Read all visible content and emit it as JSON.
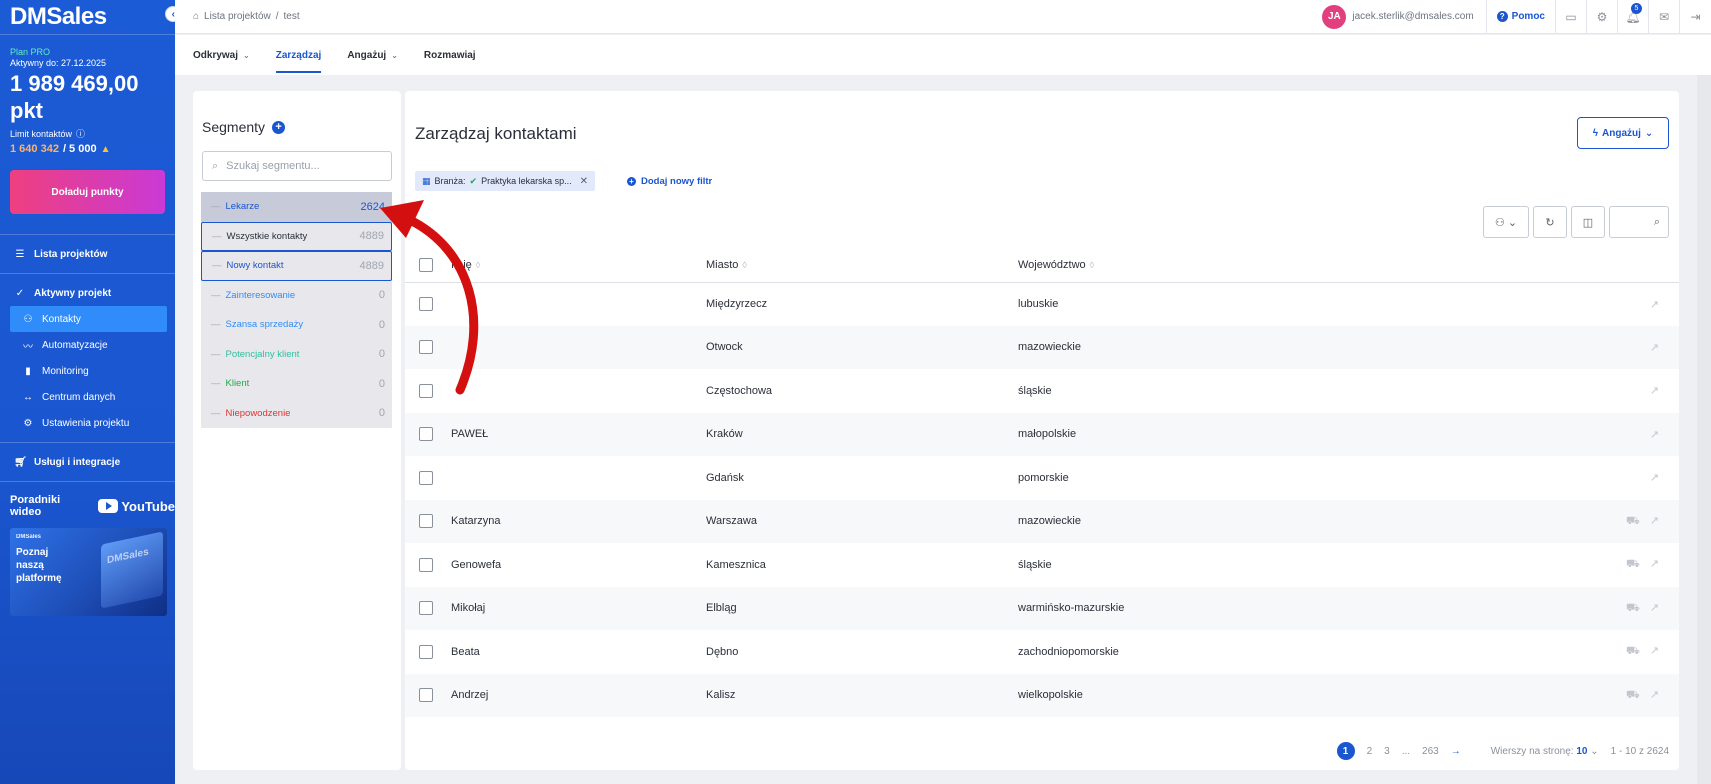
{
  "brand": {
    "logo": "DMSales"
  },
  "plan": {
    "name": "Plan PRO",
    "active_until": "Aktywny do: 27.12.2025",
    "points": "1 989 469,00",
    "points_unit": "pkt",
    "limit_label": "Limit kontaktów",
    "limit_used": "1 640 342",
    "limit_total": "/ 5 000",
    "topup_label": "Doładuj punkty"
  },
  "sidebar": {
    "items": [
      {
        "label": "Lista projektów",
        "icon": "list-icon"
      },
      {
        "label": "Aktywny projekt",
        "icon": "check-icon"
      },
      {
        "label": "Kontakty",
        "icon": "contacts-icon"
      },
      {
        "label": "Automatyzacje",
        "icon": "chart-line-icon"
      },
      {
        "label": "Monitoring",
        "icon": "bar-chart-icon"
      },
      {
        "label": "Centrum danych",
        "icon": "code-icon"
      },
      {
        "label": "Ustawienia projektu",
        "icon": "gear-icon"
      },
      {
        "label": "Usługi i integracje",
        "icon": "cart-icon"
      }
    ],
    "video_guides": "Poradniki wideo",
    "youtube": "YouTube",
    "promo_brand": "DMSales",
    "promo_text": "Poznaj naszą platformę"
  },
  "topbar": {
    "breadcrumb_root": "Lista projektów",
    "breadcrumb_sep": "/",
    "breadcrumb_current": "test",
    "avatar_initials": "JA",
    "user_email": "jacek.sterlik@dmsales.com",
    "help_label": "Pomoc",
    "notifications_count": "5"
  },
  "menu": {
    "items": [
      {
        "label": "Odkrywaj"
      },
      {
        "label": "Zarządzaj"
      },
      {
        "label": "Angażuj"
      },
      {
        "label": "Rozmawiaj"
      }
    ]
  },
  "segments": {
    "title": "Segmenty",
    "search_placeholder": "Szukaj segmentu...",
    "items": [
      {
        "name": "Lekarze",
        "count": "2624",
        "color": "#1a56cf"
      },
      {
        "name": "Wszystkie kontakty",
        "count": "4889",
        "color": "#2b2f3a"
      },
      {
        "name": "Nowy kontakt",
        "count": "4889",
        "color": "#1a56cf"
      },
      {
        "name": "Zainteresowanie",
        "count": "0",
        "color": "#2f8cf8"
      },
      {
        "name": "Szansa sprzedaży",
        "count": "0",
        "color": "#2f8cf8"
      },
      {
        "name": "Potencjalny klient",
        "count": "0",
        "color": "#2fbfa0"
      },
      {
        "name": "Klient",
        "count": "0",
        "color": "#1fa84b"
      },
      {
        "name": "Niepowodzenie",
        "count": "0",
        "color": "#e0342d"
      }
    ]
  },
  "main": {
    "title": "Zarządzaj kontaktami",
    "engage_label": "Angażuj",
    "filter_prefix": "Branża:",
    "filter_value": "Praktyka lekarska sp...",
    "add_filter": "Dodaj nowy filtr",
    "columns": [
      "Imię",
      "Miasto",
      "Województwo"
    ],
    "rows": [
      {
        "name": "",
        "city": "Międzyrzecz",
        "region": "lubuskie",
        "cart": false
      },
      {
        "name": "",
        "city": "Otwock",
        "region": "mazowieckie",
        "cart": false
      },
      {
        "name": "",
        "city": "Częstochowa",
        "region": "śląskie",
        "cart": false
      },
      {
        "name": "PAWEŁ",
        "city": "Kraków",
        "region": "małopolskie",
        "cart": false
      },
      {
        "name": "",
        "city": "Gdańsk",
        "region": "pomorskie",
        "cart": false
      },
      {
        "name": "Katarzyna",
        "city": "Warszawa",
        "region": "mazowieckie",
        "cart": true
      },
      {
        "name": "Genowefa",
        "city": "Kamesznica",
        "region": "śląskie",
        "cart": true
      },
      {
        "name": "Mikołaj",
        "city": "Elbląg",
        "region": "warmińsko-mazurskie",
        "cart": true
      },
      {
        "name": "Beata",
        "city": "Dębno",
        "region": "zachodniopomorskie",
        "cart": true
      },
      {
        "name": "Andrzej",
        "city": "Kalisz",
        "region": "wielkopolskie",
        "cart": true
      }
    ],
    "pager": {
      "current": "1",
      "pages": [
        "2",
        "3"
      ],
      "ellipsis": "...",
      "last": "263",
      "rows_per_page_label": "Wierszy na stronę:",
      "rows_per_page": "10",
      "range": "1 - 10 z 2624"
    }
  }
}
